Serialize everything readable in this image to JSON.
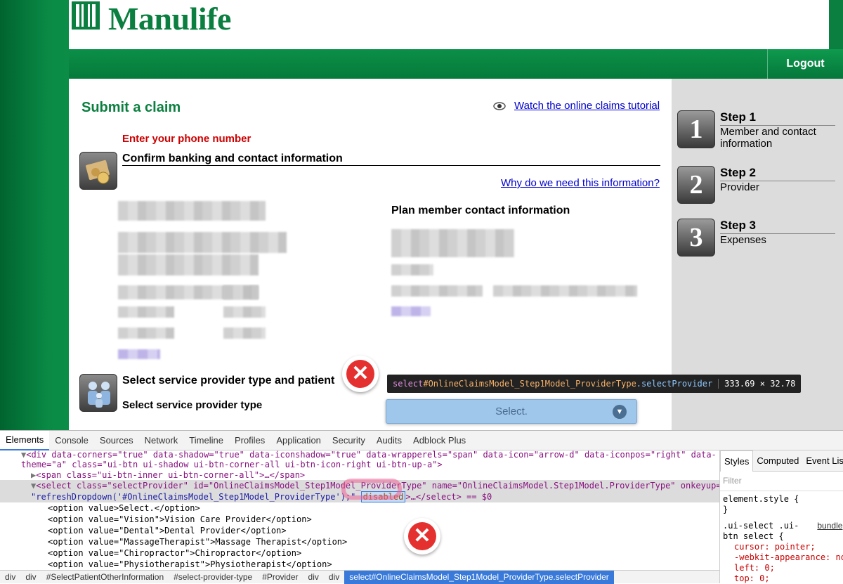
{
  "header": {
    "brand": "Manulife",
    "logout_label": "Logout"
  },
  "content": {
    "title": "Submit a claim",
    "tutorial_link": "Watch the online claims tutorial",
    "phone_heading": "Enter your phone number",
    "banking_heading": "Confirm banking and contact information",
    "why_link": "Why do we need this information?",
    "contact_heading": "Plan member contact information",
    "provider_heading": "Select service provider type and patient",
    "provider_type_label": "Select service provider type",
    "select_value": "Select.",
    "tooltip": {
      "tag": "select",
      "id": "#OnlineClaimsModel_Step1Model_ProviderType",
      "cls": ".selectProvider",
      "size": "333.69 × 32.78"
    }
  },
  "steps": [
    {
      "num": "1",
      "title": "Step 1",
      "desc": "Member and contact information"
    },
    {
      "num": "2",
      "title": "Step 2",
      "desc": "Provider"
    },
    {
      "num": "3",
      "title": "Step 3",
      "desc": "Expenses"
    }
  ],
  "devtools": {
    "tabs": [
      "Elements",
      "Console",
      "Sources",
      "Network",
      "Timeline",
      "Profiles",
      "Application",
      "Security",
      "Audits",
      "Adblock Plus"
    ],
    "dom": {
      "line1": "<div data-corners=\"true\" data-shadow=\"true\" data-iconshadow=\"true\" data-wrapperels=\"span\" data-icon=\"arrow-d\" data-iconpos=\"right\" data-",
      "line2": "theme=\"a\" class=\"ui-btn ui-shadow ui-btn-corner-all ui-btn-icon-right ui-btn-up-a\">",
      "line3": "<span class=\"ui-btn-inner ui-btn-corner-all\">…</span>",
      "line4": "<select class=\"selectProvider\" id=\"OnlineClaimsModel_Step1Model_ProviderType\" name=\"OnlineClaimsModel.Step1Model.ProviderType\" onkeyup=",
      "line5_pre": "\"refreshDropdown('#OnlineClaimsModel_Step1Model_ProviderType');\"",
      "disabled": "disabled",
      "line5_post": ">…</select> == $0",
      "options": [
        "<option value>Select.</option>",
        "<option value=\"Vision\">Vision Care Provider</option>",
        "<option value=\"Dental\">Dental Provider</option>",
        "<option value=\"MassageTherapist\">Massage Therapist</option>",
        "<option value=\"Chiropractor\">Chiropractor</option>",
        "<option value=\"Physiotherapist\">Physiotherapist</option>"
      ]
    },
    "styles": {
      "tabs": [
        "Styles",
        "Computed",
        "Event Lis"
      ],
      "filter": "Filter",
      "element_style": "element.style {",
      "close": "}",
      "rule_selector": ".ui-select .ui-",
      "rule_source": "bundle",
      "rule_selector2": "btn select {",
      "decls": [
        "cursor: pointer;",
        "-webkit-appearance: no",
        "left: 0;",
        "top: 0;"
      ]
    },
    "breadcrumbs": [
      "div",
      "div",
      "#SelectPatientOtherInformation",
      "#select-provider-type",
      "#Provider",
      "div",
      "div",
      "select#OnlineClaimsModel_Step1Model_ProviderType.selectProvider"
    ]
  }
}
